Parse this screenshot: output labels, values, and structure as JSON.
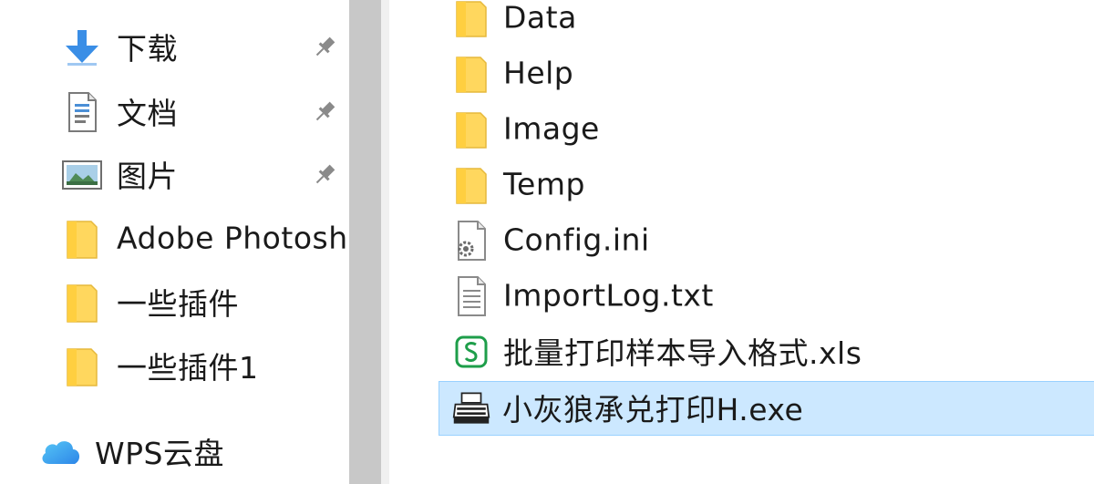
{
  "navigation": {
    "items": [
      {
        "label": "下载",
        "icon": "download-arrow-icon",
        "pinned": true
      },
      {
        "label": "文档",
        "icon": "document-icon",
        "pinned": true
      },
      {
        "label": "图片",
        "icon": "pictures-icon",
        "pinned": true
      },
      {
        "label": "Adobe Photosh",
        "icon": "folder-icon",
        "pinned": false
      },
      {
        "label": "一些插件",
        "icon": "folder-icon",
        "pinned": false
      },
      {
        "label": "一些插件1",
        "icon": "folder-icon",
        "pinned": false
      },
      {
        "label": "WPS云盘",
        "icon": "cloud-icon",
        "pinned": false
      }
    ]
  },
  "files": {
    "items": [
      {
        "name": "Data",
        "type": "folder"
      },
      {
        "name": "Help",
        "type": "folder"
      },
      {
        "name": "Image",
        "type": "folder"
      },
      {
        "name": "Temp",
        "type": "folder"
      },
      {
        "name": "Config.ini",
        "type": "settings-file"
      },
      {
        "name": "ImportLog.txt",
        "type": "text-file"
      },
      {
        "name": "批量打印样本导入格式.xls",
        "type": "spreadsheet-file"
      },
      {
        "name": "小灰狼承兑打印H.exe",
        "type": "printer-exe",
        "selected": true
      }
    ]
  },
  "colors": {
    "folder_fill": "#ffd75e",
    "selection_bg": "#cce8ff",
    "selection_border": "#99d1ff",
    "download_blue": "#3a8ee6",
    "spreadsheet_green": "#1e9e4a",
    "splitter": "#c8c8c8"
  }
}
